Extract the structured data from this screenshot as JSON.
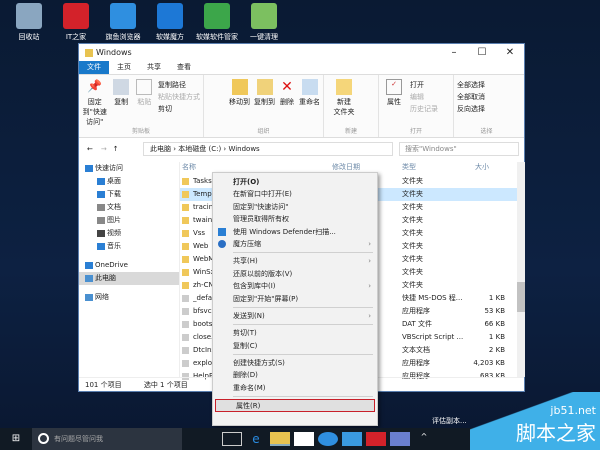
{
  "desktop": {
    "icons": [
      {
        "label": "回收站",
        "color": "#8aa6c0"
      },
      {
        "label": "IT之家",
        "color": "#d3222a"
      },
      {
        "label": "旗鱼浏览器",
        "color": "#2f8fe0"
      },
      {
        "label": "软媒魔方",
        "color": "#1d78d6"
      },
      {
        "label": "软媒软件管家",
        "color": "#3ca64a"
      },
      {
        "label": "一键清理",
        "color": "#7cc060"
      }
    ],
    "eval_text": "评估副本..."
  },
  "window": {
    "title": "Windows",
    "tabs": [
      "文件",
      "主页",
      "共享",
      "查看"
    ],
    "ribbon": {
      "clipboard": {
        "pin": "固定到\"快速访问\"",
        "copy": "复制",
        "paste": "粘贴",
        "copy_path": "复制路径",
        "paste_shortcut": "粘贴快捷方式",
        "cut": "剪切",
        "label": "剪贴板"
      },
      "organize": {
        "move": "移动到",
        "copyto": "复制到",
        "delete": "删除",
        "rename": "重命名",
        "label": "组织"
      },
      "new": {
        "folder": "新建\n文件夹",
        "label": "新建"
      },
      "open": {
        "props": "属性",
        "open": "打开",
        "edit": "编辑",
        "history": "历史记录",
        "label": "打开"
      },
      "select": {
        "all": "全部选择",
        "none": "全部取消",
        "invert": "反向选择",
        "label": "选择"
      }
    },
    "address": {
      "crumbs": [
        "此电脑",
        "本地磁盘 (C:)",
        "Windows"
      ],
      "search_placeholder": "搜索\"Windows\""
    },
    "nav": [
      "快速访问",
      "桌面",
      "下载",
      "文档",
      "图片",
      "视频",
      "音乐",
      "OneDrive",
      "此电脑",
      "网络"
    ],
    "columns": {
      "name": "名称",
      "date": "修改日期",
      "type": "类型",
      "size": "大小"
    },
    "files": [
      {
        "name": "Tasks",
        "type": "文件夹",
        "size": ""
      },
      {
        "name": "Temp",
        "type": "文件夹",
        "size": ""
      },
      {
        "name": "tracing",
        "type": "文件夹",
        "size": ""
      },
      {
        "name": "twain_32",
        "type": "文件夹",
        "size": ""
      },
      {
        "name": "Vss",
        "type": "文件夹",
        "size": ""
      },
      {
        "name": "Web",
        "type": "文件夹",
        "size": ""
      },
      {
        "name": "WebManagement",
        "type": "文件夹",
        "size": ""
      },
      {
        "name": "WinSxS",
        "type": "文件夹",
        "size": ""
      },
      {
        "name": "zh-CN",
        "type": "文件夹",
        "size": ""
      },
      {
        "name": "_default.pif",
        "type": "快捷 MS-DOS 程...",
        "size": "1 KB"
      },
      {
        "name": "bfsvc.exe",
        "type": "应用程序",
        "size": "53 KB"
      },
      {
        "name": "bootstat.dat",
        "type": "DAT 文件",
        "size": "66 KB"
      },
      {
        "name": "close.vbs",
        "type": "VBScript Script ...",
        "size": "1 KB"
      },
      {
        "name": "DtcInstall.log",
        "type": "文本文档",
        "size": "2 KB"
      },
      {
        "name": "explorer.exe",
        "type": "应用程序",
        "size": "4,203 KB"
      },
      {
        "name": "HelpPane.exe",
        "type": "应用程序",
        "size": "683 KB"
      }
    ],
    "status": {
      "count": "101 个项目",
      "selected": "选中 1 个项目"
    }
  },
  "context_menu": [
    {
      "label": "打开(O)"
    },
    {
      "label": "在新窗口中打开(E)"
    },
    {
      "label": "固定到\"快速访问\""
    },
    {
      "label": "管理员取得所有权"
    },
    {
      "label": "使用 Windows Defender扫描..."
    },
    {
      "label": "魔方压缩",
      "sub": true
    },
    {
      "sep": true
    },
    {
      "label": "共享(H)",
      "sub": true
    },
    {
      "label": "还原以前的版本(V)"
    },
    {
      "label": "包含到库中(I)",
      "sub": true
    },
    {
      "label": "固定到\"开始\"屏幕(P)"
    },
    {
      "sep": true
    },
    {
      "label": "发送到(N)",
      "sub": true
    },
    {
      "sep": true
    },
    {
      "label": "剪切(T)"
    },
    {
      "label": "复制(C)"
    },
    {
      "sep": true
    },
    {
      "label": "创建快捷方式(S)"
    },
    {
      "label": "删除(D)"
    },
    {
      "label": "重命名(M)"
    },
    {
      "sep": true
    },
    {
      "label": "属性(R)",
      "highlight": true
    }
  ],
  "taskbar": {
    "search_placeholder": "有问题尽管问我"
  },
  "watermark": {
    "site": "jb51.net",
    "name": "脚本之家"
  }
}
